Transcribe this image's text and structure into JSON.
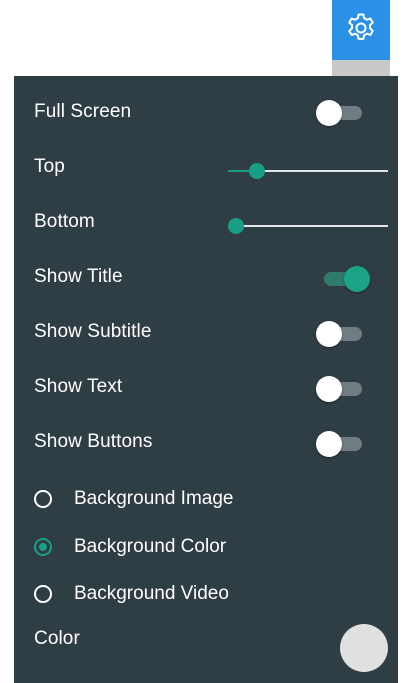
{
  "settings_button": {
    "icon": "gear-icon",
    "color": "#2a91e6"
  },
  "panel": {
    "background": "#2f3d44",
    "accent": "#18a086",
    "toggles": [
      {
        "label": "Full Screen",
        "on": false
      },
      {
        "label": "Show Title",
        "on": true
      },
      {
        "label": "Show Subtitle",
        "on": false
      },
      {
        "label": "Show Text",
        "on": false
      },
      {
        "label": "Show Buttons",
        "on": false
      }
    ],
    "sliders": [
      {
        "label": "Top",
        "value": 0.18
      },
      {
        "label": "Bottom",
        "value": 0.05
      }
    ],
    "background_options": [
      {
        "label": "Background Image",
        "selected": false
      },
      {
        "label": "Background Color",
        "selected": true
      },
      {
        "label": "Background Video",
        "selected": false
      }
    ],
    "color": {
      "label": "Color",
      "value": "#e0e0e0"
    }
  }
}
